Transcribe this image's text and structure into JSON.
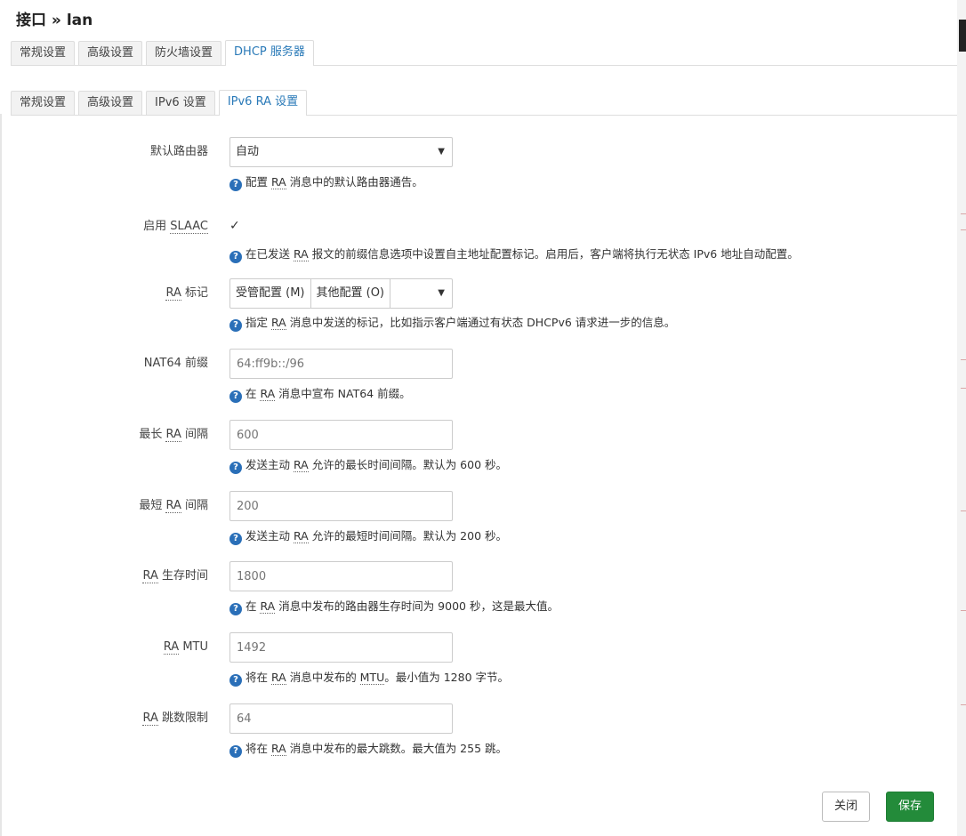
{
  "title": "接口 » lan",
  "outer_tabs": [
    "常规设置",
    "高级设置",
    "防火墙设置",
    "DHCP 服务器"
  ],
  "inner_tabs": [
    "常规设置",
    "高级设置",
    "IPv6 设置",
    "IPv6 RA 设置"
  ],
  "fields": {
    "default_router": {
      "label": "默认路由器",
      "value": "自动",
      "help_pre": "配置 ",
      "help_abbr": "RA",
      "help_post": " 消息中的默认路由器通告。"
    },
    "slaac": {
      "label_pre": "启用 ",
      "label_abbr": "SLAAC",
      "checked": "✓",
      "help_pre": "在已发送 ",
      "help_abbr": "RA",
      "help_post": " 报文的前缀信息选项中设置自主地址配置标记。启用后，客户端将执行无状态 IPv6 地址自动配置。"
    },
    "ra_flags": {
      "label_abbr": "RA",
      "label_post": " 标记",
      "opt1": "受管配置 (M)",
      "opt2": "其他配置 (O)",
      "help_pre": "指定 ",
      "help_abbr": "RA",
      "help_post": " 消息中发送的标记，比如指示客户端通过有状态 DHCPv6 请求进一步的信息。"
    },
    "nat64": {
      "label": "NAT64 前缀",
      "placeholder": "64:ff9b::/96",
      "help_pre": "在 ",
      "help_abbr": "RA",
      "help_post": " 消息中宣布 NAT64 前缀。"
    },
    "max_interval": {
      "label_pre": "最长 ",
      "label_abbr": "RA",
      "label_post": " 间隔",
      "placeholder": "600",
      "help_pre": "发送主动 ",
      "help_abbr": "RA",
      "help_post": " 允许的最长时间间隔。默认为 600 秒。"
    },
    "min_interval": {
      "label_pre": "最短 ",
      "label_abbr": "RA",
      "label_post": " 间隔",
      "placeholder": "200",
      "help_pre": "发送主动 ",
      "help_abbr": "RA",
      "help_post": " 允许的最短时间间隔。默认为 200 秒。"
    },
    "lifetime": {
      "label_abbr": "RA",
      "label_post": " 生存时间",
      "placeholder": "1800",
      "help_pre": "在 ",
      "help_abbr": "RA",
      "help_post": " 消息中发布的路由器生存时间为 9000 秒，这是最大值。"
    },
    "mtu": {
      "label_abbr": "RA",
      "label_post": " MTU",
      "placeholder": "1492",
      "help_pre": "将在 ",
      "help_abbr": "RA",
      "help_mid": " 消息中发布的 ",
      "help_abbr2": "MTU",
      "help_post": "。最小值为 1280 字节。"
    },
    "hop_limit": {
      "label_abbr": "RA",
      "label_post": " 跳数限制",
      "placeholder": "64",
      "help_pre": "将在 ",
      "help_abbr": "RA",
      "help_post": " 消息中发布的最大跳数。最大值为 255 跳。"
    }
  },
  "help_icon": "?",
  "caret": "▼",
  "buttons": {
    "close": "关闭",
    "save": "保存"
  },
  "colors": {
    "accent": "#2a7ab8",
    "save": "#238b3a",
    "help_icon": "#2a6fb8"
  }
}
